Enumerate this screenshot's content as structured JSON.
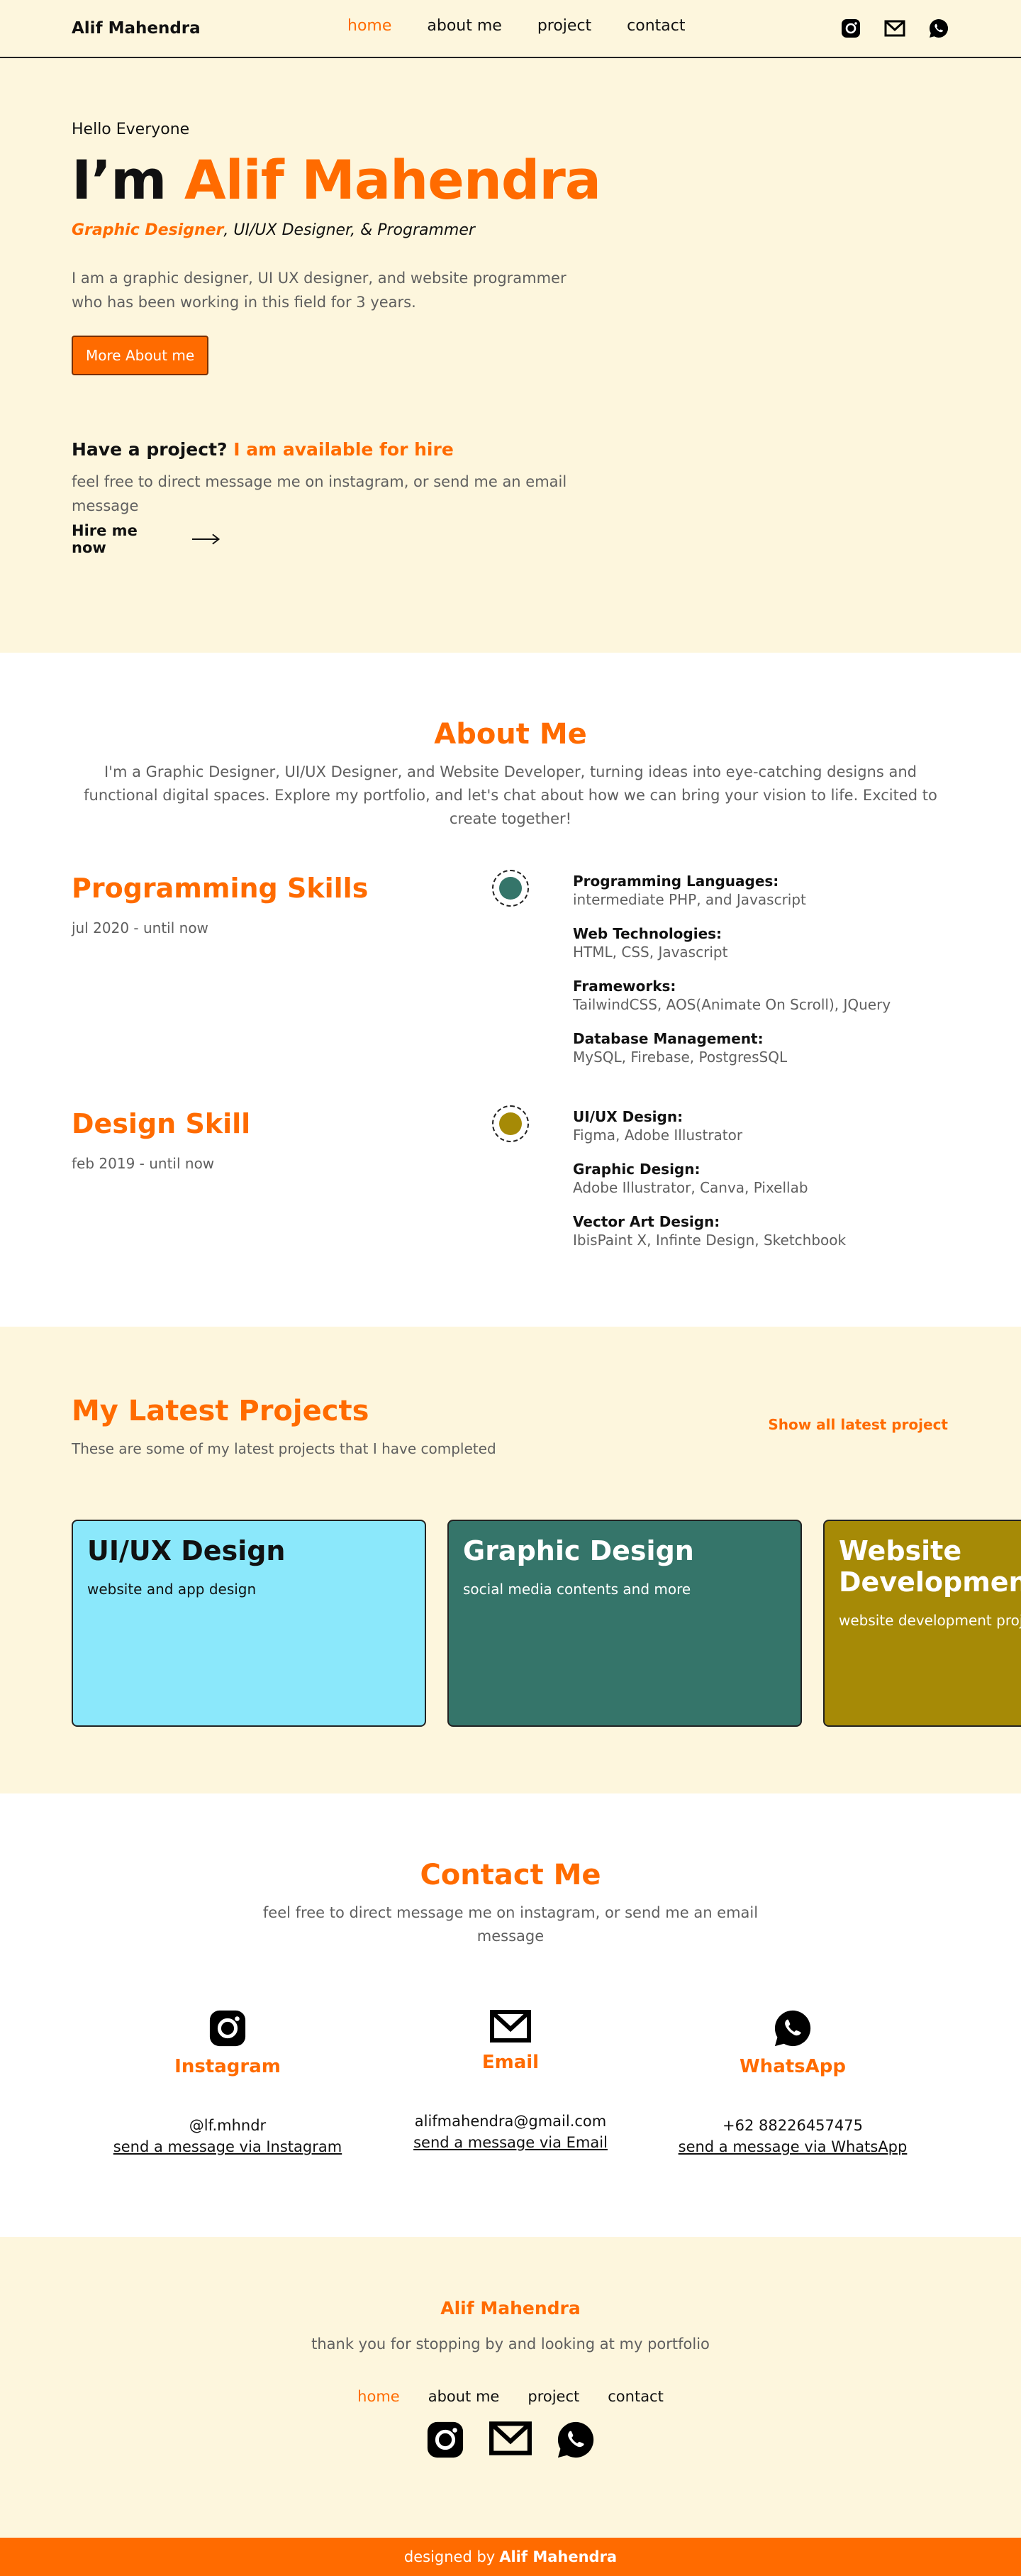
{
  "nav": {
    "brand": "Alif Mahendra",
    "links": [
      "home",
      "about me",
      "project",
      "contact"
    ]
  },
  "hero": {
    "hello": "Hello Everyone",
    "im": "I’m ",
    "name": "Alif Mahendra",
    "role_highlight": "Graphic Designer",
    "role_rest": ", UI/UX Designer, & Programmer",
    "intro": "I am a graphic designer, UI UX designer, and website programmer who has been working in this field for 3 years.",
    "button": "More About me",
    "hire_q": "Have a project?",
    "hire_a": "I am available for hire",
    "hire_text": "feel free to direct message me on instagram, or send me an email message",
    "hire_link": "Hire me now"
  },
  "about": {
    "title": "About Me",
    "text": "I'm a Graphic Designer, UI/UX Designer, and Website Developer, turning ideas into eye-catching designs and functional digital spaces. Explore my portfolio, and let's chat about how we can bring your vision to life. Excited to create together!",
    "skills": [
      {
        "title": "Programming Skills",
        "period": "jul 2020 - until now",
        "color": "#35756a",
        "items": [
          {
            "k": "Programming Languages:",
            "v": "intermediate PHP, and Javascript"
          },
          {
            "k": "Web Technologies:",
            "v": "HTML, CSS, Javascript"
          },
          {
            "k": "Frameworks:",
            "v": "TailwindCSS, AOS(Animate On Scroll), JQuery"
          },
          {
            "k": "Database Management:",
            "v": "MySQL, Firebase, PostgresSQL"
          }
        ]
      },
      {
        "title": "Design Skill",
        "period": "feb 2019 - until now",
        "color": "#a68a06",
        "items": [
          {
            "k": "UI/UX Design:",
            "v": "Figma, Adobe Illustrator"
          },
          {
            "k": "Graphic Design:",
            "v": "Adobe Illustrator, Canva, Pixellab"
          },
          {
            "k": "Vector Art Design:",
            "v": "IbisPaint X, Infinte Design, Sketchbook"
          }
        ]
      }
    ]
  },
  "projects": {
    "title": "My Latest Projects",
    "subtitle": "These are some of my latest projects that I have completed",
    "show_all": "Show all latest project",
    "cards": [
      {
        "title": "UI/UX Design",
        "desc": "website and app design",
        "bg": "#8be8fb",
        "fg": "#111111"
      },
      {
        "title": "Graphic Design",
        "desc": "social media contents and more",
        "bg": "#35756a",
        "fg": "#ffffff"
      },
      {
        "title": "Website Development",
        "desc": "website development projects",
        "bg": "#a68a06",
        "fg": "#ffffff"
      }
    ]
  },
  "contact": {
    "title": "Contact Me",
    "text": "feel free to direct message me on instagram, or send me an email message",
    "cols": [
      {
        "name": "Instagram",
        "value": "@lf.mhndr",
        "send": "send a message via Instagram",
        "icon": "instagram-icon"
      },
      {
        "name": "Email",
        "value": "alifmahendra@gmail.com",
        "send": "send a message via Email",
        "icon": "email-icon"
      },
      {
        "name": "WhatsApp",
        "value": "+62 88226457475",
        "send": "send a message via WhatsApp",
        "icon": "whatsapp-icon"
      }
    ]
  },
  "footer": {
    "name": "Alif Mahendra",
    "thanks": "thank you for stopping by and looking at my portfolio",
    "links": [
      "home",
      "about me",
      "project",
      "contact"
    ],
    "credit_prefix": "designed by",
    "credit_name": "Alif Mahendra"
  }
}
